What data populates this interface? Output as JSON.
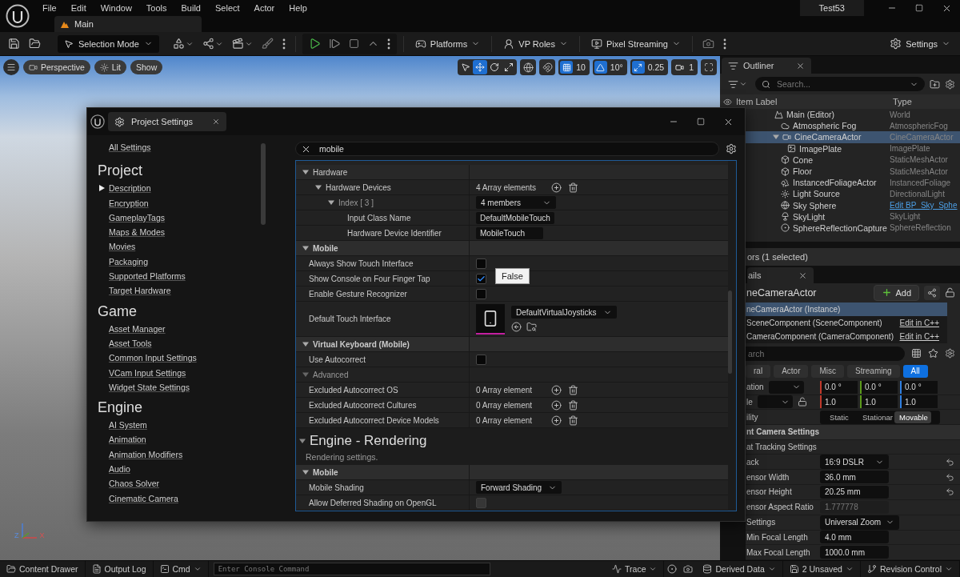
{
  "menu_bar": {
    "menus": [
      "File",
      "Edit",
      "Window",
      "Tools",
      "Build",
      "Select",
      "Actor",
      "Help"
    ],
    "project_name": "Test53"
  },
  "level_tab": {
    "label": "Main"
  },
  "toolbar": {
    "mode": "Selection Mode",
    "menus": [
      {
        "label": "Platforms",
        "kind": "platforms"
      },
      {
        "label": "VP Roles",
        "kind": "roles"
      },
      {
        "label": "Pixel Streaming",
        "kind": "streaming"
      }
    ],
    "settings": "Settings"
  },
  "viewport": {
    "view_buttons": [
      {
        "label": "Perspective",
        "kind": "camera"
      },
      {
        "label": "Lit",
        "kind": "lit"
      },
      {
        "label": "Show",
        "kind": "plain"
      }
    ],
    "tools": [
      {
        "kind": "select",
        "selected": false
      },
      {
        "kind": "move",
        "selected": true
      },
      {
        "kind": "rotate",
        "selected": false
      },
      {
        "kind": "scale",
        "selected": false
      }
    ],
    "snaps": [
      {
        "kind": "grid",
        "value": "10",
        "on": true
      },
      {
        "kind": "angle",
        "value": "10°",
        "on": true
      },
      {
        "kind": "scale",
        "value": "0.25",
        "on": true
      },
      {
        "kind": "camera",
        "value": "1",
        "on": false
      }
    ],
    "axis_labels": [
      "Z",
      "X"
    ]
  },
  "outliner": {
    "title": "Outliner",
    "search": {
      "placeholder": "Search..."
    },
    "columns": [
      "Item Label",
      "Type"
    ],
    "rows": [
      {
        "label": "Main (Editor)",
        "type": "World",
        "kind": "world",
        "selected": false,
        "children": [
          {
            "label": "Atmospheric Fog",
            "type": "AtmosphericFog",
            "kind": "fog",
            "selected": false
          },
          {
            "label": "CineCameraActor",
            "type": "CineCameraActor",
            "kind": "camera",
            "selected": true,
            "expanded": true,
            "children": [
              {
                "label": "ImagePlate",
                "type": "ImagePlate",
                "kind": "image",
                "selected": false
              }
            ]
          },
          {
            "label": "Cone",
            "type": "StaticMeshActor",
            "kind": "mesh",
            "selected": false
          },
          {
            "label": "Floor",
            "type": "StaticMeshActor",
            "kind": "mesh",
            "selected": false
          },
          {
            "label": "InstancedFoliageActor",
            "type": "InstancedFoliage",
            "kind": "foliage",
            "selected": false
          },
          {
            "label": "Light Source",
            "type": "DirectionalLight",
            "kind": "light",
            "selected": false
          },
          {
            "label": "Sky Sphere",
            "type": "Edit BP_Sky_Sphe",
            "kind": "sky",
            "selected": false,
            "link": true
          },
          {
            "label": "SkyLight",
            "type": "SkyLight",
            "kind": "skylight",
            "selected": false
          },
          {
            "label": "SphereReflectionCapture",
            "type": "SphereReflection",
            "kind": "reflection",
            "selected": false
          }
        ]
      }
    ]
  },
  "details_panel": {
    "selection_summary": "ors (1 selected)",
    "tab": "ails",
    "actor": "neCameraActor",
    "add_button": "Add",
    "components": [
      {
        "label": "neCameraActor (Instance)",
        "selected": true
      },
      {
        "label": "SceneComponent (SceneComponent)",
        "action": "Edit in C++",
        "selected": false
      },
      {
        "label": "CameraComponent (CameraComponent)",
        "action": "Edit in C++",
        "selected": false
      }
    ],
    "search": {
      "placeholder": "arch"
    },
    "filters": [
      {
        "label": "ral",
        "selected": false
      },
      {
        "label": "Actor",
        "selected": false
      },
      {
        "label": "Misc",
        "selected": false
      },
      {
        "label": "Streaming",
        "selected": false
      },
      {
        "label": "All",
        "selected": true
      }
    ],
    "properties": [
      {
        "kind": "vector",
        "label": "ation",
        "values": [
          "0.0 °",
          "0.0 °",
          "0.0 °"
        ]
      },
      {
        "kind": "vector",
        "label": "le",
        "lock": true,
        "values": [
          "1.0",
          "1.0",
          "1.0"
        ]
      },
      {
        "kind": "segmented",
        "label": "ility",
        "options": [
          {
            "label": "Static",
            "selected": false
          },
          {
            "label": "Stationar",
            "selected": false
          },
          {
            "label": "Movable",
            "selected": true
          }
        ]
      },
      {
        "kind": "section",
        "label": "nt Camera Settings"
      },
      {
        "kind": "group",
        "label": "at Tracking Settings"
      },
      {
        "kind": "combo",
        "label": "ack",
        "value": "16:9 DSLR",
        "resettable": true
      },
      {
        "kind": "text",
        "label": "ensor Width",
        "value": "36.0 mm",
        "resettable": true
      },
      {
        "kind": "text",
        "label": "ensor Height",
        "value": "20.25 mm",
        "resettable": true
      },
      {
        "kind": "readonly",
        "label": "ensor Aspect Ratio",
        "value": "1.777778"
      },
      {
        "kind": "combo",
        "label": "Settings",
        "value": "Universal Zoom",
        "children": [
          {
            "kind": "text",
            "label": "Min Focal Length",
            "value": "4.0 mm"
          },
          {
            "kind": "text",
            "label": "Max Focal Length",
            "value": "1000.0 mm"
          }
        ]
      }
    ]
  },
  "settings_window": {
    "title": "Project Settings",
    "nav": {
      "all_settings": "All Settings",
      "sections": [
        {
          "heading": "Project",
          "items": [
            {
              "label": "Description",
              "marker": true
            },
            {
              "label": "Encryption"
            },
            {
              "label": "GameplayTags"
            },
            {
              "label": "Maps & Modes"
            },
            {
              "label": "Movies"
            },
            {
              "label": "Packaging"
            },
            {
              "label": "Supported Platforms"
            },
            {
              "label": "Target Hardware"
            }
          ]
        },
        {
          "heading": "Game",
          "items": [
            {
              "label": "Asset Manager"
            },
            {
              "label": "Asset Tools"
            },
            {
              "label": "Common Input Settings"
            },
            {
              "label": "VCam Input Settings"
            },
            {
              "label": "Widget State Settings"
            }
          ]
        },
        {
          "heading": "Engine",
          "items": [
            {
              "label": "AI System"
            },
            {
              "label": "Animation"
            },
            {
              "label": "Animation Modifiers"
            },
            {
              "label": "Audio"
            },
            {
              "label": "Chaos Solver"
            },
            {
              "label": "Cinematic Camera"
            }
          ]
        }
      ]
    },
    "search": {
      "value": "mobile"
    },
    "properties": [
      {
        "kind": "group",
        "label": "Hardware",
        "expanded": true,
        "children": [
          {
            "kind": "array",
            "label": "Hardware Devices",
            "value": "4 Array elements",
            "expanded": true,
            "children": [
              {
                "kind": "struct",
                "label": "Index [ 3 ]",
                "value": "4 members",
                "expanded": true,
                "children": [
                  {
                    "kind": "text",
                    "label": "Input Class Name",
                    "value": "DefaultMobileTouch"
                  },
                  {
                    "kind": "text",
                    "label": "Hardware Device Identifier",
                    "value": "MobileTouch"
                  }
                ]
              }
            ]
          }
        ]
      },
      {
        "kind": "category",
        "label": "Mobile",
        "expanded": true,
        "children": [
          {
            "kind": "checkbox",
            "label": "Always Show Touch Interface",
            "checked": false,
            "disabled": false
          },
          {
            "kind": "checkbox",
            "label": "Show Console on Four Finger Tap",
            "checked": true,
            "disabled": false,
            "tooltip": "False"
          },
          {
            "kind": "checkbox",
            "label": "Enable Gesture Recognizer",
            "checked": false,
            "disabled": false
          },
          {
            "kind": "asset",
            "label": "Default Touch Interface",
            "value": "DefaultVirtualJoysticks"
          }
        ]
      },
      {
        "kind": "category",
        "label": "Virtual Keyboard (Mobile)",
        "expanded": true,
        "children": [
          {
            "kind": "checkbox",
            "label": "Use Autocorrect",
            "checked": false,
            "disabled": false
          },
          {
            "kind": "advanced",
            "label": "Advanced",
            "expanded": true
          },
          {
            "kind": "array",
            "label": "Excluded Autocorrect OS",
            "value": "0 Array element"
          },
          {
            "kind": "array",
            "label": "Excluded Autocorrect Cultures",
            "value": "0 Array element"
          },
          {
            "kind": "array",
            "label": "Excluded Autocorrect Device Models",
            "value": "0 Array element"
          }
        ]
      },
      {
        "kind": "heading",
        "label": "Engine - Rendering",
        "description": "Rendering settings.",
        "expanded": true
      },
      {
        "kind": "category",
        "label": "Mobile",
        "expanded": true,
        "children": [
          {
            "kind": "combo",
            "label": "Mobile Shading",
            "value": "Forward Shading"
          },
          {
            "kind": "checkbox",
            "label": "Allow Deferred Shading on OpenGL",
            "checked": false,
            "disabled": true
          }
        ]
      }
    ]
  },
  "status_bar": {
    "left": [
      {
        "label": "Content Drawer",
        "kind": "drawer"
      },
      {
        "label": "Output Log",
        "kind": "log"
      },
      {
        "label": "Cmd",
        "kind": "cmd"
      }
    ],
    "console": {
      "placeholder": "Enter Console Command"
    },
    "right": [
      {
        "label": "Trace",
        "kind": "trace"
      },
      {
        "label": "Derived Data",
        "kind": "ddc"
      },
      {
        "label": "2 Unsaved",
        "kind": "unsaved"
      },
      {
        "label": "Revision Control",
        "kind": "vcs"
      }
    ]
  }
}
